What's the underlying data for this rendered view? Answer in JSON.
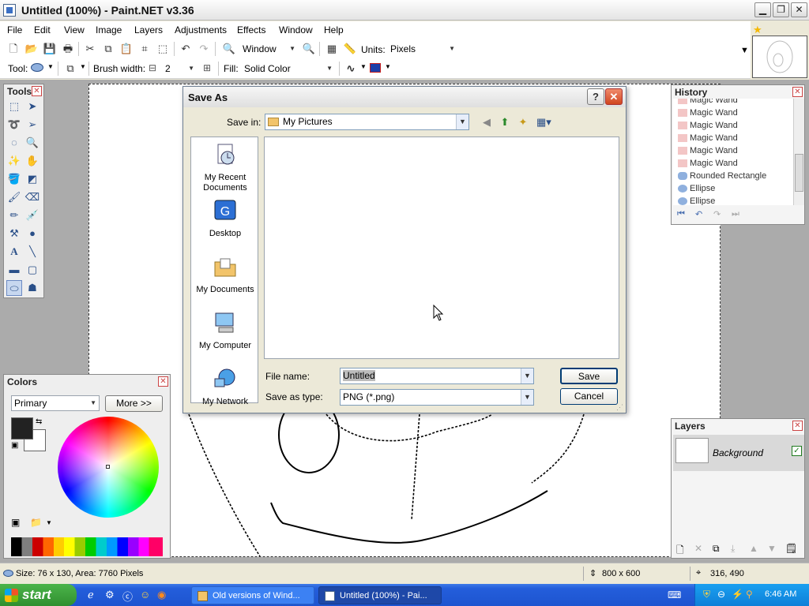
{
  "window": {
    "title": "Untitled (100%) - Paint.NET v3.36"
  },
  "menu": [
    "File",
    "Edit",
    "View",
    "Image",
    "Layers",
    "Adjustments",
    "Effects",
    "Window",
    "Help"
  ],
  "toolbar": {
    "zoom_label": "Window",
    "units_label": "Units:",
    "units_value": "Pixels",
    "tool_label": "Tool:",
    "brush_width_label": "Brush width:",
    "brush_width_minus": "⊟",
    "brush_width_value": "2",
    "brush_width_plus": "⊞",
    "fill_label": "Fill:",
    "fill_value": "Solid Color"
  },
  "panels": {
    "tools_title": "Tools",
    "history_title": "History",
    "history_items": [
      "Magic Wand",
      "Magic Wand",
      "Magic Wand",
      "Magic Wand",
      "Magic Wand",
      "Magic Wand",
      "Rounded Rectangle",
      "Ellipse",
      "Ellipse"
    ],
    "colors_title": "Colors",
    "colors_mode": "Primary",
    "colors_more": "More >>",
    "layers_title": "Layers",
    "layer_name": "Background"
  },
  "dialog": {
    "title": "Save As",
    "help_btn": "?",
    "close_btn": "✕",
    "save_in_label": "Save in:",
    "save_in_value": "My Pictures",
    "places": [
      "My Recent Documents",
      "Desktop",
      "My Documents",
      "My Computer",
      "My Network"
    ],
    "file_name_label": "File name:",
    "file_name_value": "Untitled",
    "save_as_type_label": "Save as type:",
    "save_as_type_value": "PNG (*.png)",
    "save_btn": "Save",
    "cancel_btn": "Cancel"
  },
  "status": {
    "selection": "Size: 76 x 130, Area: 7760 Pixels",
    "image_size": "800 x 600",
    "cursor_pos": "316, 490"
  },
  "taskbar": {
    "start": "start",
    "tasks": [
      "Old versions of Wind...",
      "Untitled (100%) - Pai..."
    ],
    "clock": "6:46 AM"
  },
  "colors": {
    "xp_blue": "#245edb",
    "start_green": "#3c9e3c",
    "panel_bg": "#eeeeee",
    "workspace": "#ababab"
  }
}
